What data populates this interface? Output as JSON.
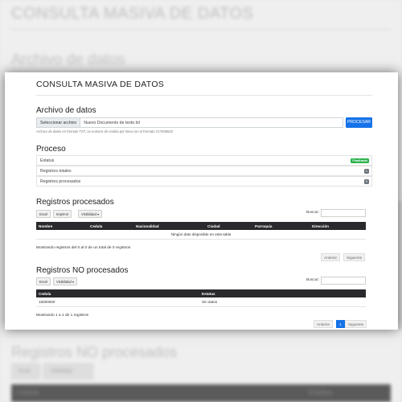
{
  "background": {
    "page_title": "CONSULTA MASIVA DE DATOS",
    "section_file": "Archivo de datos",
    "section_not_processed": "Registros NO procesados",
    "buttons": [
      "Excel",
      "Visibilidad"
    ],
    "columns": [
      "Cedula",
      "Estatus"
    ]
  },
  "card": {
    "title": "CONSULTA MASIVA DE DATOS",
    "file_section": {
      "heading": "Archivo de datos",
      "select_label": "Seleccionar archivo",
      "file_name": "Nuevo Documento de texto.txt",
      "process_label": "PROCESAR",
      "help_text": "Archivo de datos en formato TXT, un numero de cedula por linea con el formato V17508632"
    },
    "process_section": {
      "heading": "Proceso",
      "rows": [
        {
          "label": "Estatus",
          "badge": "Finalizado"
        },
        {
          "label": "Registros totales",
          "badge": "1"
        },
        {
          "label": "Registros procesados",
          "badge": "0"
        }
      ]
    },
    "processed": {
      "heading": "Registros procesados",
      "buttons": {
        "excel": "Excel",
        "print": "Imprimir",
        "visibility": "Visibilidad"
      },
      "search_label": "Buscar:",
      "columns": [
        "Nombre",
        "Cedula",
        "Nacionalidad",
        "Ciudad",
        "Parroquia",
        "Dirección"
      ],
      "empty_text": "Ningún dato disponible en esta tabla",
      "info": "Mostrando registros del 0 al 0 de un total de 0 registros",
      "prev": "Anterior",
      "next": "Siguiente"
    },
    "not_processed": {
      "heading": "Registros NO procesados",
      "buttons": {
        "excel": "Excel",
        "visibility": "Visibilidad"
      },
      "search_label": "Buscar:",
      "columns": [
        "Cedula",
        "Estatus"
      ],
      "rows": [
        {
          "cedula": "15000000",
          "estatus": "Sin datos"
        }
      ],
      "info": "Mostrando 1 a 1 de 1 registros",
      "prev": "Anterior",
      "page": "1",
      "next": "Siguiente"
    }
  }
}
